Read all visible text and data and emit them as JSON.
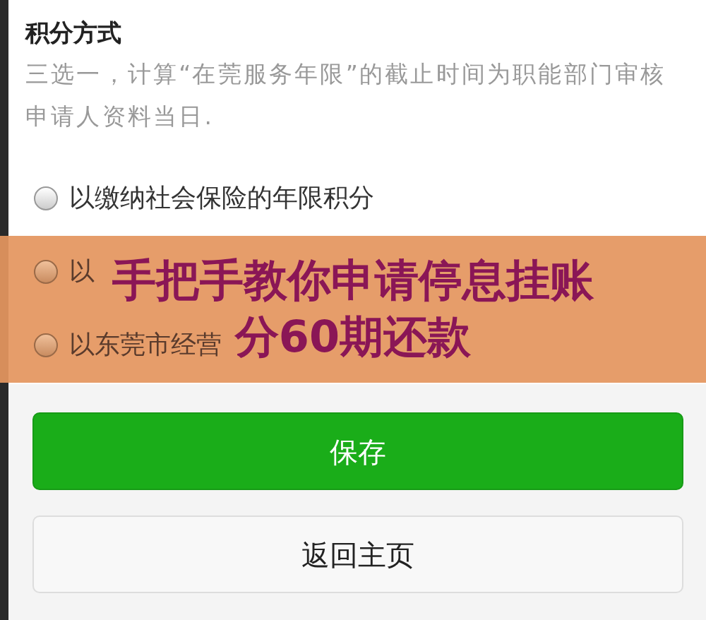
{
  "section": {
    "title": "积分方式",
    "description": "三选一，计算“在莞服务年限”的截止时间为职能部门审核申请人资料当日."
  },
  "options": [
    {
      "label": "以缴纳社会保险的年限积分",
      "selected": false
    },
    {
      "label": "以",
      "selected": false
    },
    {
      "label": "以东莞市经营",
      "selected": false
    }
  ],
  "banner": {
    "lines": [
      "手把手教你申请停息挂账",
      "分60期还款"
    ]
  },
  "buttons": [
    {
      "label": "保存",
      "kind": "primary"
    },
    {
      "label": "返回主页",
      "kind": "default"
    }
  ]
}
